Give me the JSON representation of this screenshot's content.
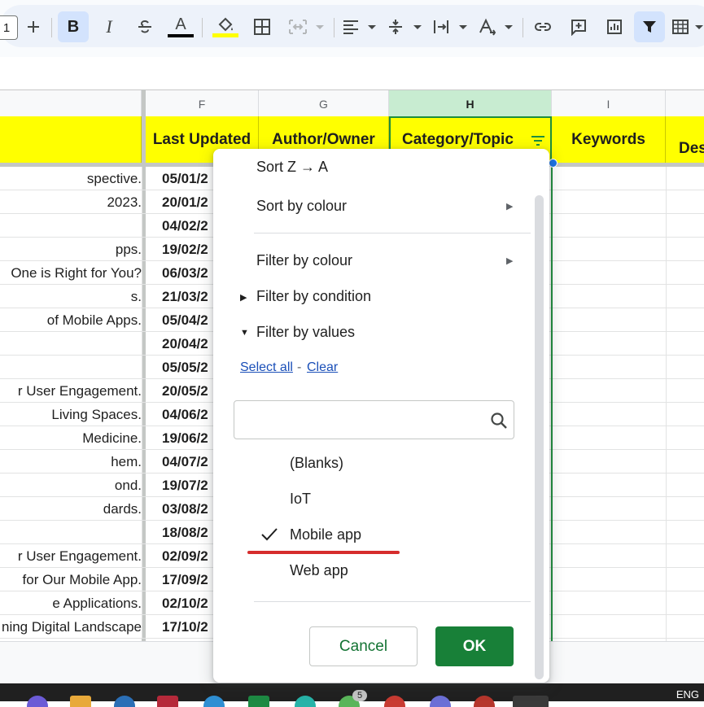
{
  "toolbar": {
    "zoom_value": "1",
    "items": [
      "plus-icon",
      "bold-icon",
      "italic-icon",
      "strikethrough-icon",
      "text-color-icon",
      "fill-color-icon",
      "borders-icon",
      "merge-cells-icon",
      "align-horizontal-icon",
      "align-vertical-icon",
      "text-wrap-icon",
      "text-rotation-icon",
      "link-icon",
      "comment-icon",
      "chart-icon",
      "filter-icon",
      "table-icon"
    ],
    "text_color": "#000000",
    "fill_color": "#ffff00",
    "bold_active_bg": "#d3e3fd"
  },
  "columns": [
    {
      "letter": "F"
    },
    {
      "letter": "G"
    },
    {
      "letter": "H",
      "selected": true
    },
    {
      "letter": "I"
    }
  ],
  "headers": {
    "E": "",
    "F": "Last Updated",
    "G": "Author/Owner",
    "H": "Category/Topic",
    "I": "Keywords",
    "J": "Des"
  },
  "rows": [
    {
      "e": "spective.",
      "f": "05/01/2"
    },
    {
      "e": "2023.",
      "f": "20/01/2"
    },
    {
      "e": "",
      "f": "04/02/2"
    },
    {
      "e": "pps.",
      "f": "19/02/2"
    },
    {
      "e": "One is Right for You?",
      "f": "06/03/2"
    },
    {
      "e": "s.",
      "f": "21/03/2"
    },
    {
      "e": "of Mobile Apps.",
      "f": "05/04/2"
    },
    {
      "e": "",
      "f": "20/04/2"
    },
    {
      "e": "",
      "f": "05/05/2"
    },
    {
      "e": "r User Engagement.",
      "f": "20/05/2"
    },
    {
      "e": "Living Spaces.",
      "f": "04/06/2"
    },
    {
      "e": "Medicine.",
      "f": "19/06/2"
    },
    {
      "e": "hem.",
      "f": "04/07/2"
    },
    {
      "e": "ond.",
      "f": "19/07/2"
    },
    {
      "e": "dards.",
      "f": "03/08/2"
    },
    {
      "e": "",
      "f": "18/08/2"
    },
    {
      "e": "r User Engagement.",
      "f": "02/09/2"
    },
    {
      "e": "for Our Mobile App.",
      "f": "17/09/2"
    },
    {
      "e": "e Applications.",
      "f": "02/10/2"
    },
    {
      "e": "ning Digital Landscape",
      "f": "17/10/2"
    }
  ],
  "filter_menu": {
    "sort_z_a": "Sort Z → A",
    "sort_by_colour": "Sort by colour",
    "filter_by_colour": "Filter by colour",
    "filter_by_condition": "Filter by condition",
    "filter_by_values": "Filter by values",
    "select_all": "Select all",
    "separator": "-",
    "clear": "Clear",
    "search_placeholder": "",
    "values": [
      {
        "label": "(Blanks)",
        "checked": false
      },
      {
        "label": "IoT",
        "checked": false
      },
      {
        "label": "Mobile app",
        "checked": true
      },
      {
        "label": "Web app",
        "checked": false
      }
    ],
    "cancel_label": "Cancel",
    "ok_label": "OK"
  },
  "taskbar": {
    "badge_count": "5",
    "language": "ENG"
  }
}
